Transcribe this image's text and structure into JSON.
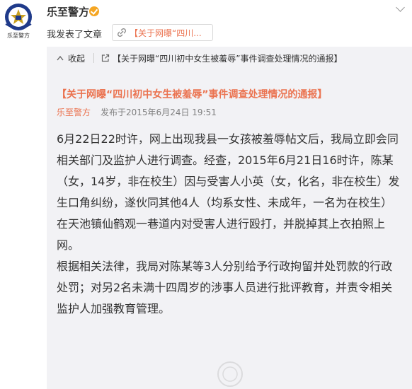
{
  "header": {
    "account_name": "乐至警方",
    "action": "我发表了文章",
    "article_link": "【关于网曝“四川...",
    "avatar_text": "乐至警方"
  },
  "card": {
    "collapse_label": "收起",
    "title_link": "【关于网曝“四川初中女生被羞辱”事件调查处理情况的通报】"
  },
  "article": {
    "title": "【关于网曝“四川初中女生被羞辱”事件调查处理情况的通报】",
    "author": "乐至警方",
    "published": "发布于2015年6月24日 19:51",
    "lines": [
      "6月22日22时许，网上出现我县一女孩被羞辱帖文后，我局立即会同",
      "相关部门及监护人进行调查。经查，2015年6月21日16时许，陈某",
      "（女，14岁，非在校生）因与受害人小英（女，化名，非在校生）发",
      "生口角纠纷，遂伙同其他4人（均系女性、未成年，一名为在校生）",
      "在天池镇仙鹤观一巷道内对受害人进行殴打，并脱掉其上衣拍照上",
      "网。",
      "根据相关法律，我局对陈某等3人分别给予行政拘留并处罚款的行政",
      "处罚；对另2名未满十四周岁的涉事人员进行批评教育，并责令相关",
      "监护人加强教育管理。"
    ]
  },
  "colors": {
    "accent": "#eb7350",
    "card_bg": "#f2f2f5",
    "emblem_blue": "#1f3a8a"
  },
  "icons": [
    "police-emblem",
    "verified-badge",
    "chevron-down",
    "link",
    "chevron-up",
    "external-link"
  ]
}
